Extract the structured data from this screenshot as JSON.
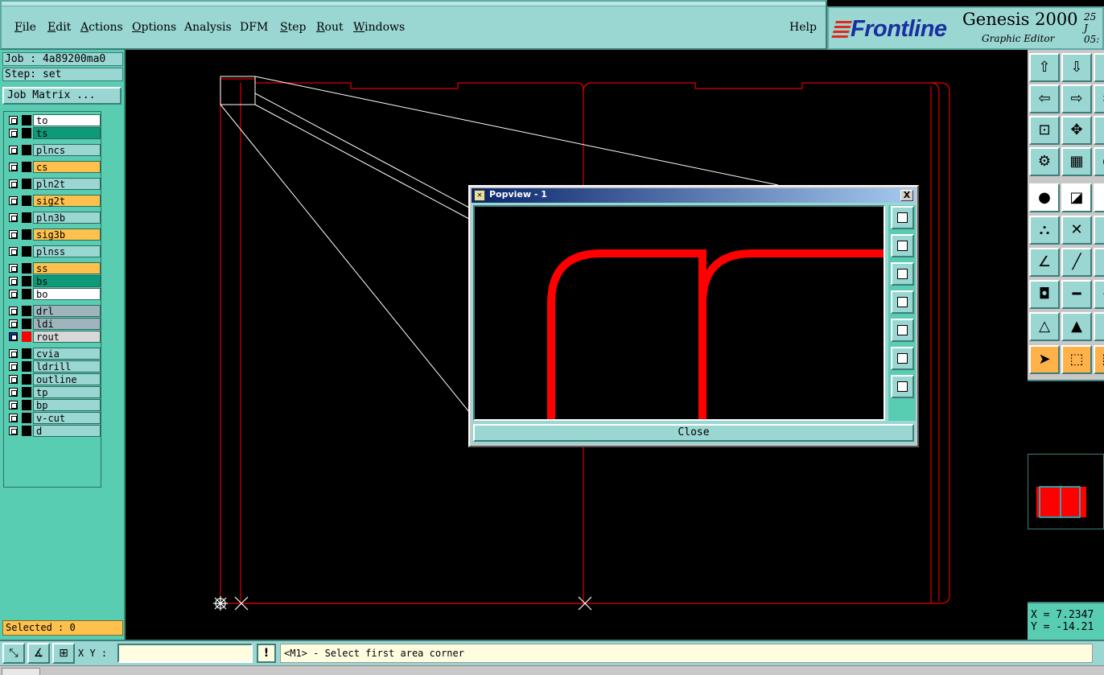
{
  "menu": {
    "items": [
      "File",
      "Edit",
      "Actions",
      "Options",
      "Analysis",
      "DFM",
      "Step",
      "Rout",
      "Windows"
    ],
    "help": "Help"
  },
  "brand": {
    "logo": "Frontline",
    "title": "Genesis 2000",
    "subtitle": "Graphic Editor",
    "date_line1": "25 J",
    "date_line2": "05:"
  },
  "job": {
    "job_line": "Job : 4a89200ma0",
    "step_line": "Step: set",
    "matrix_button": "Job Matrix ..."
  },
  "layers": [
    {
      "name": "to",
      "color": "#ffffff"
    },
    {
      "name": "ts",
      "color": "#0e9a78"
    },
    {
      "name": "plncs",
      "color": "#9ad6d2"
    },
    {
      "name": "cs",
      "color": "#ffc14d"
    },
    {
      "name": "pln2t",
      "color": "#9ad6d2"
    },
    {
      "name": "sig2t",
      "color": "#ffc14d"
    },
    {
      "name": "pln3b",
      "color": "#9ad6d2"
    },
    {
      "name": "sig3b",
      "color": "#ffc14d"
    },
    {
      "name": "plnss",
      "color": "#9ad6d2"
    },
    {
      "name": "ss",
      "color": "#ffc14d"
    },
    {
      "name": "bs",
      "color": "#0e9a78"
    },
    {
      "name": "bo",
      "color": "#ffffff"
    },
    {
      "name": "drl",
      "color": "#9fb4bd"
    },
    {
      "name": "ldi",
      "color": "#9fb4bd"
    },
    {
      "name": "rout",
      "color": "#d8d8d8",
      "active": true
    },
    {
      "name": "cvia",
      "color": "#9ad6d2"
    },
    {
      "name": "ldrill",
      "color": "#9ad6d2"
    },
    {
      "name": "outline",
      "color": "#9ad6d2"
    },
    {
      "name": "tp",
      "color": "#9ad6d2"
    },
    {
      "name": "bp",
      "color": "#9ad6d2"
    },
    {
      "name": "v-cut",
      "color": "#9ad6d2"
    },
    {
      "name": "d",
      "color": "#9ad6d2"
    }
  ],
  "selected": "Selected : 0",
  "popview": {
    "title": "Popview - 1",
    "close_label": "Close",
    "close_x": "X"
  },
  "coords": {
    "x": "X = 7.2347",
    "y": "Y = -14.21"
  },
  "status": {
    "xy_label": "X Y :",
    "xy_value": "",
    "msg_icon": "!",
    "message": "<M1> - Select first area corner"
  },
  "colors": {
    "panel": "#9ad6d2",
    "panel_dark": "#58cdb2",
    "rout_line": "#e00000",
    "selected_bg": "#ffc14d"
  }
}
